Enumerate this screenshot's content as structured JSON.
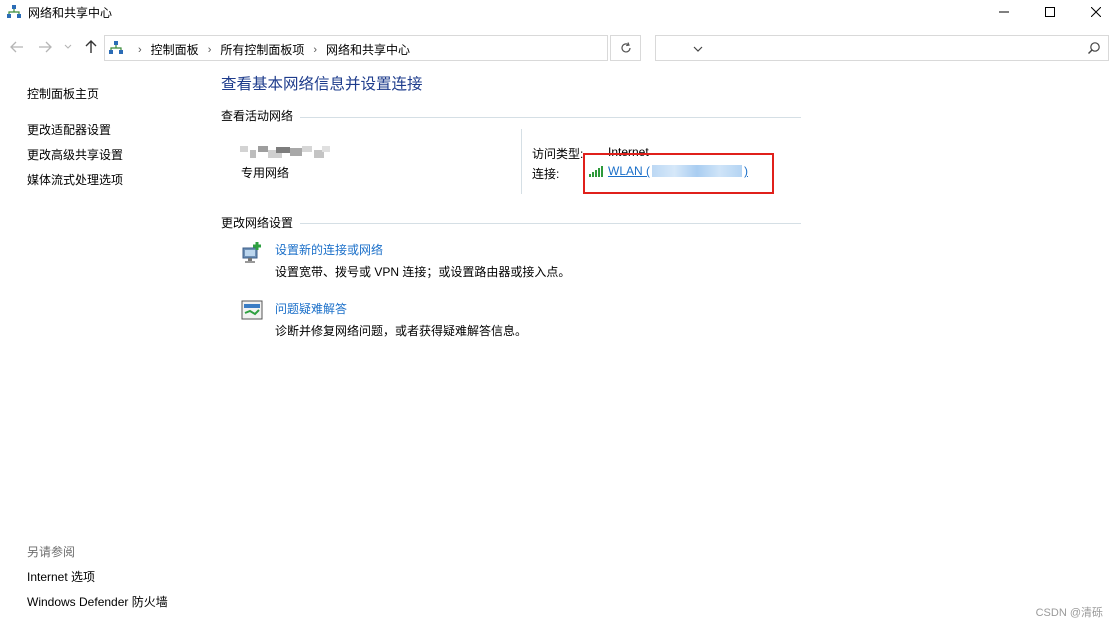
{
  "window": {
    "title": "网络和共享中心",
    "minimize_icon": "minimize-icon",
    "maximize_icon": "maximize-icon",
    "close_icon": "close-icon"
  },
  "navigation": {
    "back_icon": "arrow-left-icon",
    "forward_icon": "arrow-right-icon",
    "up_icon": "arrow-up-icon",
    "breadcrumbs": [
      "控制面板",
      "所有控制面板项",
      "网络和共享中心"
    ],
    "search_placeholder": "",
    "refresh_icon": "refresh-icon"
  },
  "sidebar": {
    "home": "控制面板主页",
    "items": [
      "更改适配器设置",
      "更改高级共享设置",
      "媒体流式处理选项"
    ],
    "see_also_heading": "另请参阅",
    "see_also": [
      "Internet 选项",
      "Windows Defender 防火墙"
    ]
  },
  "main": {
    "title": "查看基本网络信息并设置连接",
    "active_networks_heading": "查看活动网络",
    "network": {
      "type": "专用网络",
      "access_type_label": "访问类型:",
      "access_type_value": "Internet",
      "connections_label": "连接:",
      "connection_prefix": "WLAN (",
      "connection_suffix": ")"
    },
    "change_settings_heading": "更改网络设置",
    "tasks": [
      {
        "title": "设置新的连接或网络",
        "desc": "设置宽带、拨号或 VPN 连接；或设置路由器或接入点。"
      },
      {
        "title": "问题疑难解答",
        "desc": "诊断并修复网络问题，或者获得疑难解答信息。"
      }
    ]
  },
  "watermark": "CSDN @清砾",
  "colors": {
    "title_blue": "#1e3c8c",
    "link_blue": "#1a6fc9",
    "highlight_red": "#e0201b"
  }
}
